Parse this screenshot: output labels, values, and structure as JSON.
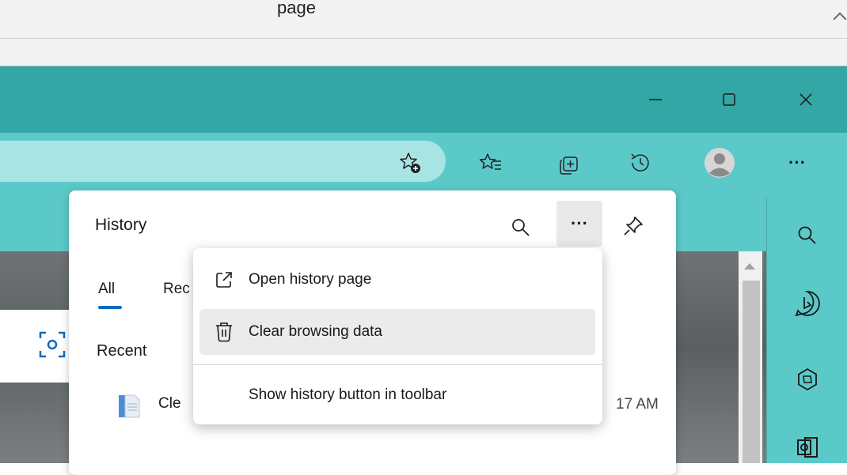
{
  "outer": {
    "title_fragment": "page"
  },
  "window": {
    "minimize": "—",
    "maximize": "☐",
    "close": "✕"
  },
  "toolbar": {
    "more_label": "···"
  },
  "history": {
    "title": "History",
    "more_label": "···",
    "tabs": [
      {
        "label": "All"
      },
      {
        "label": "Rec"
      }
    ],
    "recent_heading": "Recent",
    "entry": {
      "title": "Cle",
      "time": "17 AM"
    }
  },
  "menu": {
    "items": [
      {
        "label": "Open history page",
        "icon": "open-external-icon"
      },
      {
        "label": "Clear browsing data",
        "icon": "trash-icon"
      },
      {
        "label": "Show history button in toolbar"
      }
    ]
  },
  "colors": {
    "titlebar": "#33a6a6",
    "toolbar": "#5cc9c9",
    "accent": "#0f6cbd"
  }
}
